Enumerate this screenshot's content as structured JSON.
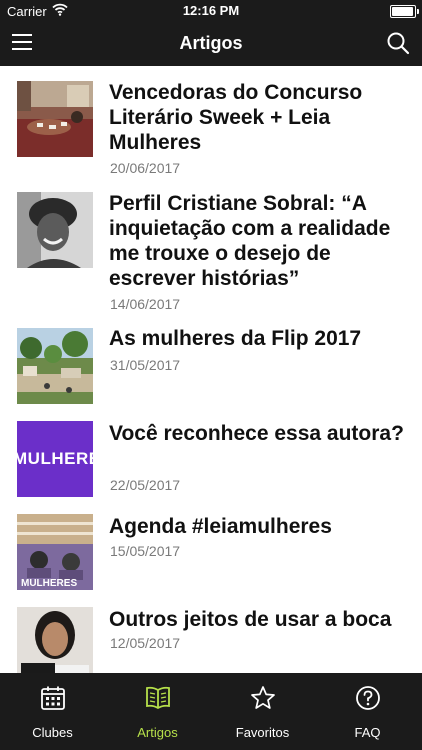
{
  "status_bar": {
    "carrier": "Carrier",
    "time": "12:16 PM"
  },
  "nav": {
    "title": "Artigos"
  },
  "articles": [
    {
      "title": "Vencedoras do Concurso Literário Sweek + Leia Mulheres",
      "date": "20/06/2017",
      "thumb_icon": "photo-room-thumbnail"
    },
    {
      "title": "Perfil Cristiane Sobral: “A inquietação com a realidade me trouxe o desejo de escrever histórias”",
      "date": "14/06/2017",
      "thumb_icon": "portrait-photo-thumbnail"
    },
    {
      "title": "As mulheres da Flip 2017",
      "date": "31/05/2017",
      "thumb_icon": "landscape-photo-thumbnail"
    },
    {
      "title": "Você reconhece essa autora?",
      "date": "22/05/2017",
      "thumb_icon": "mulheres-logo-thumbnail",
      "thumb_text": "MULHERE"
    },
    {
      "title": "Agenda #leiamulheres",
      "date": "15/05/2017",
      "thumb_icon": "agenda-poster-thumbnail",
      "thumb_text": "MULHERES"
    },
    {
      "title": "Outros jeitos de usar a boca",
      "date": "12/05/2017",
      "thumb_icon": "book-cover-thumbnail"
    }
  ],
  "tabs": [
    {
      "label": "Clubes",
      "icon": "calendar-icon",
      "active": false
    },
    {
      "label": "Artigos",
      "icon": "book-icon",
      "active": true
    },
    {
      "label": "Favoritos",
      "icon": "star-icon",
      "active": false
    },
    {
      "label": "FAQ",
      "icon": "question-icon",
      "active": false
    }
  ],
  "colors": {
    "bar_background": "#1b1b1b",
    "accent": "#b6e04a",
    "date_text": "#7a7a7a",
    "purple_brand": "#6b2fc9"
  }
}
